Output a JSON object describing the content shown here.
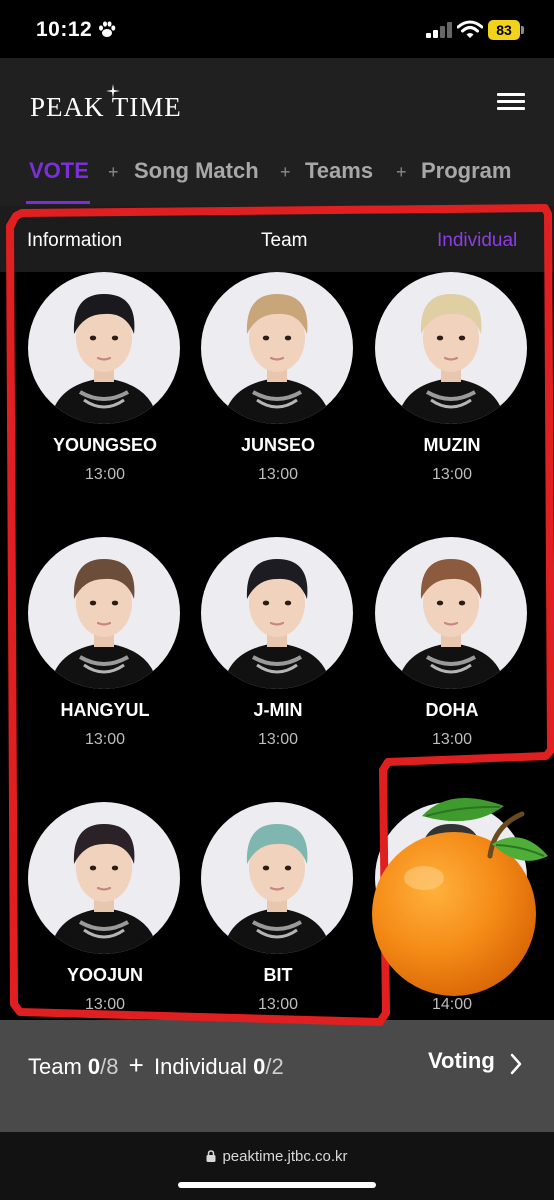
{
  "status_bar": {
    "time": "10:12",
    "battery": "83"
  },
  "header": {
    "logo": "PEAK TIME",
    "tabs": [
      {
        "label": "VOTE"
      },
      {
        "label": "Song Match"
      },
      {
        "label": "Teams"
      },
      {
        "label": "Program"
      }
    ],
    "active_tab": "VOTE"
  },
  "subtabs": [
    {
      "label": "Information"
    },
    {
      "label": "Team"
    },
    {
      "label": "Individual"
    }
  ],
  "contestants": [
    {
      "name": "YOUNGSEO",
      "time": "13:00",
      "hair": "#1a1a1e"
    },
    {
      "name": "JUNSEO",
      "time": "13:00",
      "hair": "#c9a57a"
    },
    {
      "name": "MUZIN",
      "time": "13:00",
      "hair": "#e0cfa3"
    },
    {
      "name": "HANGYUL",
      "time": "13:00",
      "hair": "#6b4d3a"
    },
    {
      "name": "J-MIN",
      "time": "13:00",
      "hair": "#1c1c22"
    },
    {
      "name": "DOHA",
      "time": "13:00",
      "hair": "#8c5a3c"
    },
    {
      "name": "YOOJUN",
      "time": "13:00",
      "hair": "#2a2226"
    },
    {
      "name": "BIT",
      "time": "13:00",
      "hair": "#7fb7b0"
    },
    {
      "name": "",
      "time": "14:00",
      "hair": "#333333"
    }
  ],
  "vote_bar": {
    "team_label": "Team",
    "team_count": "0",
    "team_total": "8",
    "individual_label": "Individual",
    "individual_count": "0",
    "individual_total": "2",
    "voting_label": "Voting"
  },
  "browser": {
    "url": "peaktime.jtbc.co.kr"
  },
  "colors": {
    "accent": "#7b2fd9",
    "annotation": "#e02020"
  }
}
